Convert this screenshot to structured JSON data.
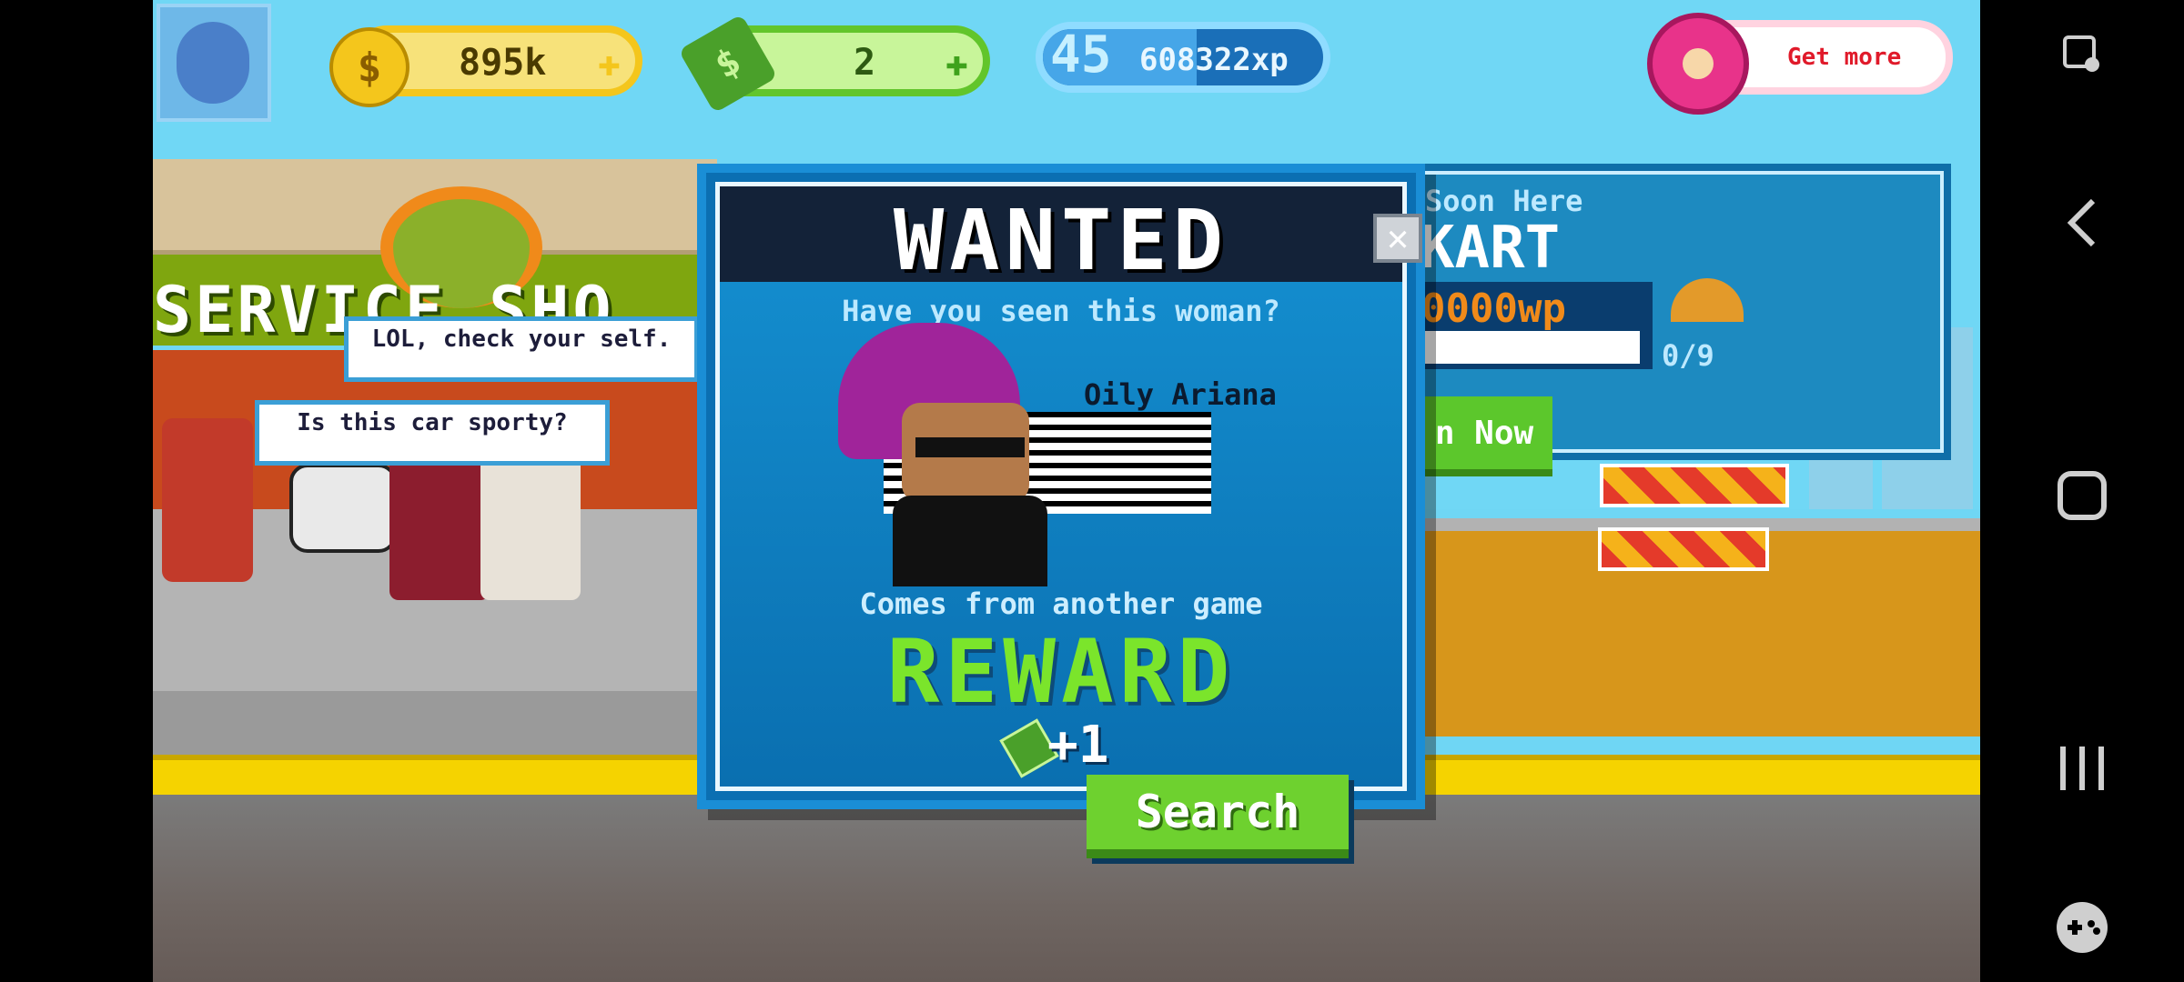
{
  "hud": {
    "coins": "895k",
    "cash": "2",
    "level": "45",
    "xp": "608322xp",
    "level_progress": 0.55,
    "get_more_label": "Get more"
  },
  "scene": {
    "shop_sign": "SERVICE SHO",
    "bubble_1": "LOL, check your self.",
    "bubble_2": "Is this car sporty?"
  },
  "soon_panel": {
    "title": "Soon Here",
    "name": "KART",
    "cost": "0000wp",
    "progress": "0/9",
    "button": "n Now"
  },
  "wanted": {
    "title": "WANTED",
    "question": "Have you seen this woman?",
    "name": "Oily Ariana",
    "origin": "Comes from another game",
    "reward_label": "REWARD",
    "reward_amount": "+1",
    "search_label": "Search"
  },
  "colors": {
    "reward": "#7be52b",
    "button": "#6ed12f",
    "modal": "#0b6fb2"
  }
}
